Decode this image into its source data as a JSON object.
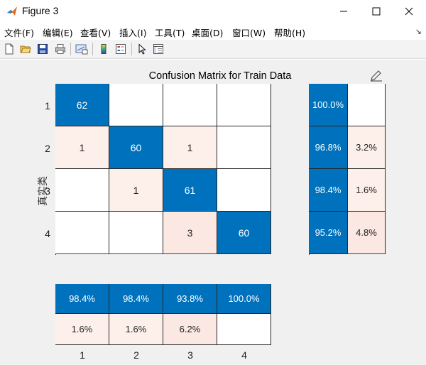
{
  "window": {
    "title": "Figure 3",
    "icon": "matlab-icon",
    "controls": [
      "minimize-icon",
      "maximize-icon",
      "close-icon"
    ]
  },
  "menubar": {
    "items": [
      "文件(F)",
      "编辑(E)",
      "查看(V)",
      "插入(I)",
      "工具(T)",
      "桌面(D)",
      "窗口(W)",
      "帮助(H)"
    ],
    "overflow_icon": "dock-arrow-icon"
  },
  "toolbar": {
    "buttons": [
      "new-figure-icon",
      "open-file-icon",
      "save-icon",
      "print-icon",
      "link-plot-icon",
      "insert-colorbar-icon",
      "insert-legend-icon",
      "pointer-icon",
      "property-inspector-icon"
    ]
  },
  "figure": {
    "title": "Confusion Matrix for Train Data",
    "ylabel": "真实类",
    "row_labels": [
      "1",
      "2",
      "3",
      "4"
    ],
    "col_labels": [
      "1",
      "2",
      "3",
      "4"
    ],
    "colors": {
      "dark": "#0072bd",
      "light_tint": "#fdf0eb",
      "medium_tint": "#fbe8e3",
      "white": "#ffffff",
      "border": "#262626"
    }
  },
  "chart_data": {
    "type": "heatmap",
    "title": "Confusion Matrix for Train Data",
    "ylabel": "真实类",
    "xlabel": "",
    "classes": [
      "1",
      "2",
      "3",
      "4"
    ],
    "matrix": [
      [
        62,
        null,
        null,
        null
      ],
      [
        1,
        60,
        1,
        null
      ],
      [
        null,
        1,
        61,
        null
      ],
      [
        null,
        null,
        3,
        60
      ]
    ],
    "matrix_text": [
      [
        "62",
        "",
        "",
        ""
      ],
      [
        "1",
        "60",
        "1",
        ""
      ],
      [
        "",
        "1",
        "61",
        ""
      ],
      [
        "",
        "",
        "3",
        "60"
      ]
    ],
    "row_summary": {
      "correct_text": [
        "100.0%",
        "96.8%",
        "98.4%",
        "95.2%"
      ],
      "incorrect_text": [
        "",
        "3.2%",
        "1.6%",
        "4.8%"
      ],
      "correct": [
        100.0,
        96.8,
        98.4,
        95.2
      ],
      "incorrect": [
        0,
        3.2,
        1.6,
        4.8
      ]
    },
    "column_summary": {
      "correct_text": [
        "98.4%",
        "98.4%",
        "93.8%",
        "100.0%"
      ],
      "incorrect_text": [
        "1.6%",
        "1.6%",
        "6.2%",
        ""
      ],
      "correct": [
        98.4,
        98.4,
        93.8,
        100.0
      ],
      "incorrect": [
        1.6,
        1.6,
        6.2,
        0
      ]
    }
  }
}
